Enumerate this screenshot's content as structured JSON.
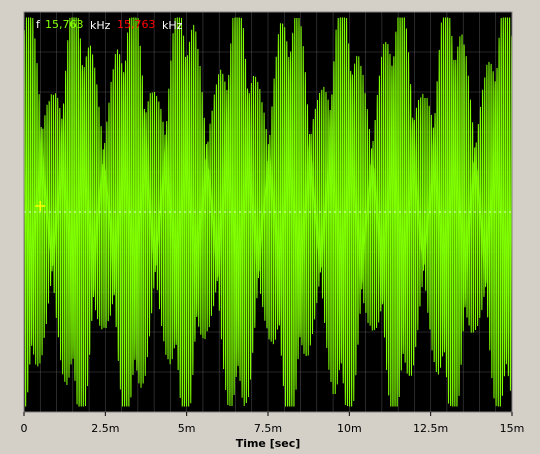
{
  "readout": {
    "prefix": "f",
    "value_green": "15,763",
    "unit_1": "kHz",
    "value_red": "15,763",
    "unit_2": "kHz",
    "colors": {
      "prefix": "#ffffff",
      "green": "#80ff00",
      "red": "#ff0000",
      "unit": "#ffffff"
    }
  },
  "chart_data": {
    "type": "line",
    "xlabel": "Time [sec]",
    "ylabel": "",
    "title": "",
    "xlim": [
      0,
      0.015
    ],
    "x_ticks": [
      0,
      0.0025,
      0.005,
      0.0075,
      0.01,
      0.0125,
      0.015
    ],
    "x_tick_labels": [
      "0",
      "2.5m",
      "5m",
      "7.5m",
      "10m",
      "12.5m",
      "15m"
    ],
    "ylim": [
      -1,
      1
    ],
    "grid": true,
    "series": [
      {
        "color": "#80ff00",
        "carrier_frequency_khz": 15.763,
        "description_points": "high-frequency oscillation with beating envelope",
        "envelope_amplitude_range": [
          0.4,
          0.95
        ]
      }
    ],
    "cursor": {
      "x": 0.0005,
      "y": 0.0,
      "color": "#ffff00"
    },
    "background": "#000000",
    "grid_color": "#808080"
  }
}
